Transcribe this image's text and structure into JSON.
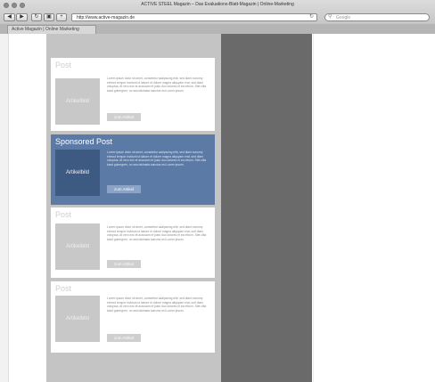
{
  "window": {
    "title": "ACTIVE STEEL Magazin – Das Evaluations-Blatt-Magazin | Online-Marketing"
  },
  "toolbar": {
    "back_icon": "back-arrow",
    "forward_icon": "forward-arrow",
    "url": "http://www.active-magazin.de",
    "search_placeholder": "Google"
  },
  "tabs": [
    {
      "label": "Active Magazin | Online Marketing"
    }
  ],
  "colors": {
    "sponsored_bg": "#5b7aa5",
    "sponsored_image": "#3d5a83",
    "post_image": "#c8c8c8",
    "main_column": "#c4c4c4",
    "sidebar_column": "#6a6a6a"
  },
  "posts": [
    {
      "title": "Post",
      "image_label": "Artikelbild",
      "text": "Lorem ipsum dolor sit amet, consetetur sadipscing elitr, sed diam nonumy eirmod tempor invidunt ut labore et dolore magna aliquyam erat, sed diam voluptua. At vero eos et accusam et justo duo dolores et ea rebum. Stet clita kasd gubergren, no sea takimata sanctus est Lorem ipsum.",
      "button": "zum Artikel"
    },
    {
      "title": "Sponsored Post",
      "image_label": "Artikelbild",
      "text": "Lorem ipsum dolor sit amet, consetetur sadipscing elitr, sed diam nonumy eirmod tempor invidunt ut labore et dolore magna aliquyam erat, sed diam voluptua. At vero eos et accusam et justo duo dolores et ea rebum. Stet clita kasd gubergren, no sea takimata sanctus est Lorem ipsum.",
      "button": "zum Artikel"
    },
    {
      "title": "Post",
      "image_label": "Artikelbild",
      "text": "Lorem ipsum dolor sit amet, consetetur sadipscing elitr, sed diam nonumy eirmod tempor invidunt ut labore et dolore magna aliquyam erat, sed diam voluptua. At vero eos et accusam et justo duo dolores et ea rebum. Stet clita kasd gubergren, no sea takimata sanctus est Lorem ipsum.",
      "button": "zum Artikel"
    },
    {
      "title": "Post",
      "image_label": "Artikelbild",
      "text": "Lorem ipsum dolor sit amet, consetetur sadipscing elitr, sed diam nonumy eirmod tempor invidunt ut labore et dolore magna aliquyam erat, sed diam voluptua. At vero eos et accusam et justo duo dolores et ea rebum. Stet clita kasd gubergren, no sea takimata sanctus est Lorem ipsum.",
      "button": "zum Artikel"
    }
  ]
}
